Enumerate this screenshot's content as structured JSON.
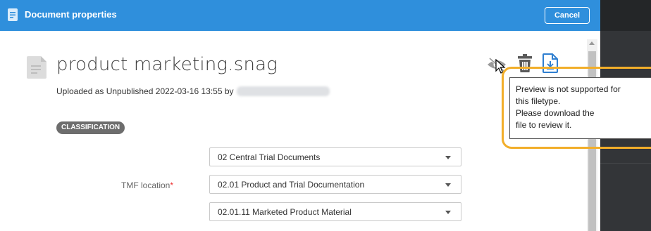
{
  "dialog": {
    "title": "Document properties",
    "cancel_label": "Cancel"
  },
  "document": {
    "filename": "product marketing.snag",
    "upload_text": "Uploaded as Unpublished 2022-03-16 13:55 by"
  },
  "section": {
    "badge": "CLASSIFICATION"
  },
  "tmf": {
    "label": "TMF location",
    "required_mark": "*",
    "selects": [
      "02 Central Trial Documents",
      "02.01 Product and Trial Documentation",
      "02.01.11 Marketed Product Material"
    ]
  },
  "tooltip": {
    "lines": [
      "Preview is not supported for",
      "this filetype.",
      "Please download the",
      "file to review it."
    ]
  },
  "icons": {
    "title": "document-icon",
    "doc": "file-icon",
    "preview": "eye-slash-icon",
    "delete": "trash-icon",
    "download": "file-download-icon"
  },
  "colors": {
    "header": "#2f8fdc",
    "highlight": "#f2ae2a",
    "badge": "#6d6d6d"
  }
}
